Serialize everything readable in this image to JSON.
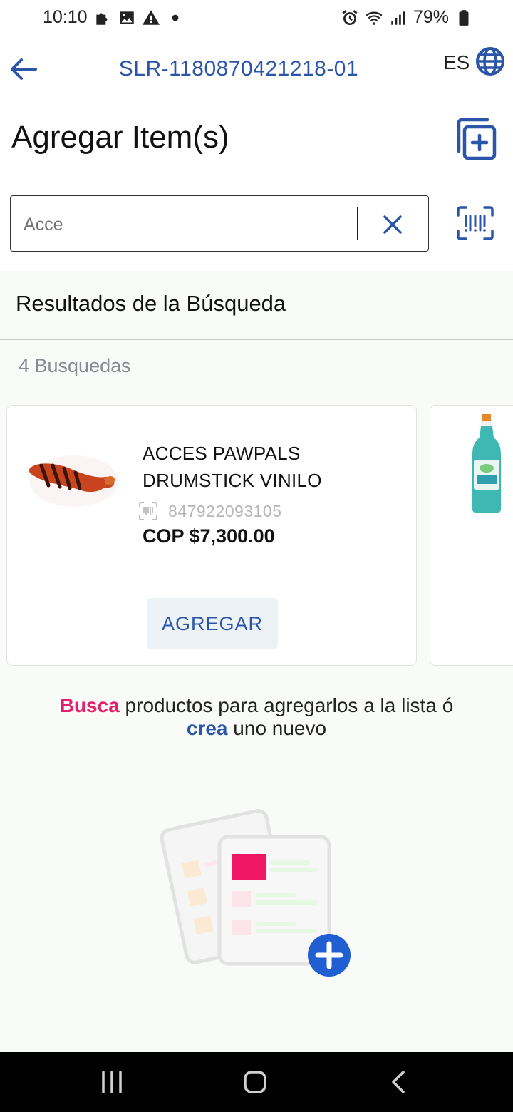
{
  "status_bar": {
    "time": "10:10",
    "battery_percent": "79%",
    "icons_left": [
      "puzzle-icon",
      "image-icon",
      "warning-icon",
      "dot-icon"
    ],
    "icons_right": [
      "alarm-icon",
      "wifi-icon",
      "signal-icon",
      "battery-icon"
    ]
  },
  "header": {
    "order_id": "SLR-1180870421218-01",
    "language": "ES"
  },
  "page": {
    "title": "Agregar Item(s)"
  },
  "search": {
    "value": "Acce",
    "placeholder": "Acce"
  },
  "results": {
    "title": "Resultados de la Búsqueda",
    "count_label": "4 Busquedas",
    "items": [
      {
        "name": "ACCES PAWPALS DRUMSTICK VINILO",
        "sku": "847922093105",
        "price": "COP $7,300.00",
        "add_label": "AGREGAR"
      }
    ]
  },
  "hint": {
    "part1_emphasis": "Busca",
    "part2": " productos para agregarlos a la lista ó ",
    "part3_emphasis": "crea",
    "part4": " uno nuevo"
  },
  "colors": {
    "accent_blue": "#2a55a8",
    "accent_pink": "#e5206a",
    "background": "#f9fbf9"
  }
}
